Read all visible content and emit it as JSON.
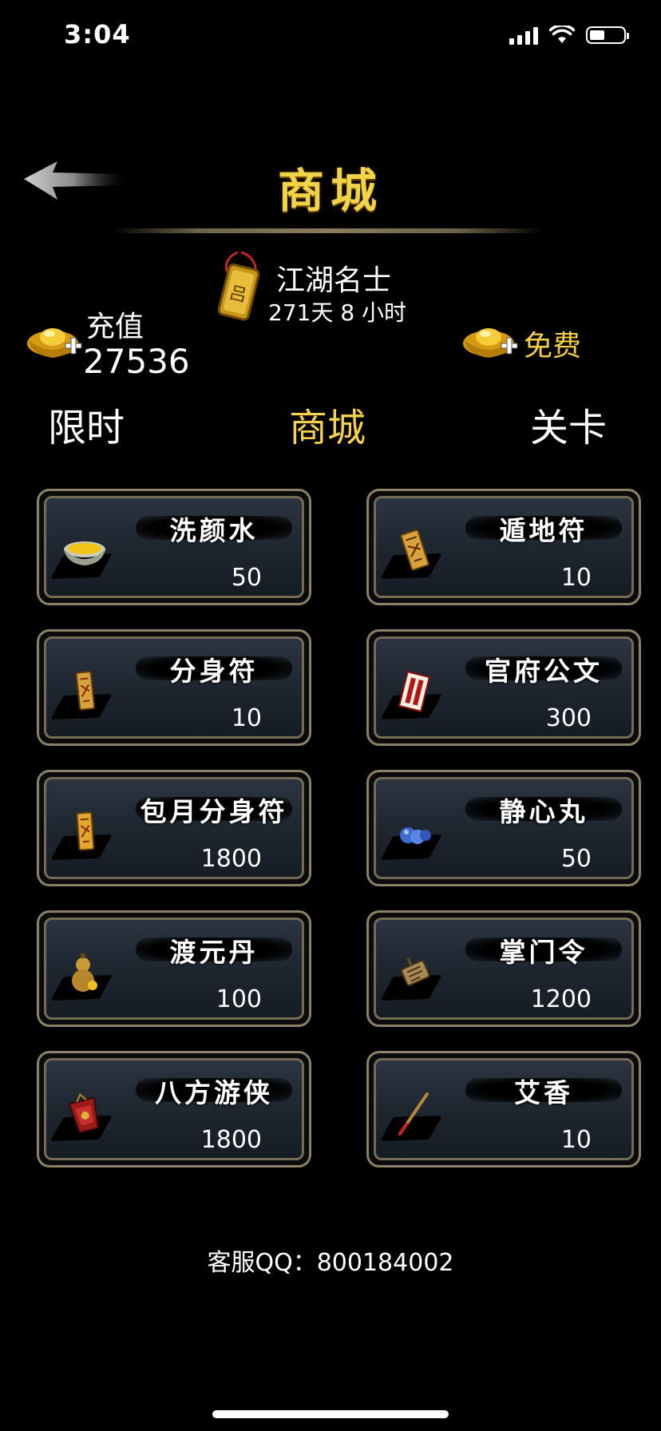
{
  "status_bar": {
    "time": "3:04"
  },
  "header": {
    "title": "商城"
  },
  "member": {
    "name": "江湖名士",
    "remaining": "271天 8 小时"
  },
  "currency": {
    "recharge_label": "充值",
    "recharge_value": "27536",
    "free_label": "免费"
  },
  "tabs": [
    {
      "label": "限时"
    },
    {
      "label": "商城"
    },
    {
      "label": "关卡"
    }
  ],
  "items": [
    {
      "name": "洗颜水",
      "price": "50",
      "icon": "bowl-icon"
    },
    {
      "name": "遁地符",
      "price": "10",
      "icon": "talisman-icon"
    },
    {
      "name": "分身符",
      "price": "10",
      "icon": "talisman-icon"
    },
    {
      "name": "官府公文",
      "price": "300",
      "icon": "scroll-icon"
    },
    {
      "name": "包月分身符",
      "price": "1800",
      "icon": "talisman-icon"
    },
    {
      "name": "静心丸",
      "price": "50",
      "icon": "pill-icon"
    },
    {
      "name": "渡元丹",
      "price": "100",
      "icon": "gourd-icon"
    },
    {
      "name": "掌门令",
      "price": "1200",
      "icon": "token-icon"
    },
    {
      "name": "八方游侠",
      "price": "1800",
      "icon": "pouch-icon"
    },
    {
      "name": "艾香",
      "price": "10",
      "icon": "incense-icon"
    }
  ],
  "footer": {
    "contact": "客服QQ：800184002"
  },
  "colors": {
    "accent": "#f1d34a",
    "background": "#000000",
    "card_border": "#8a8266"
  }
}
